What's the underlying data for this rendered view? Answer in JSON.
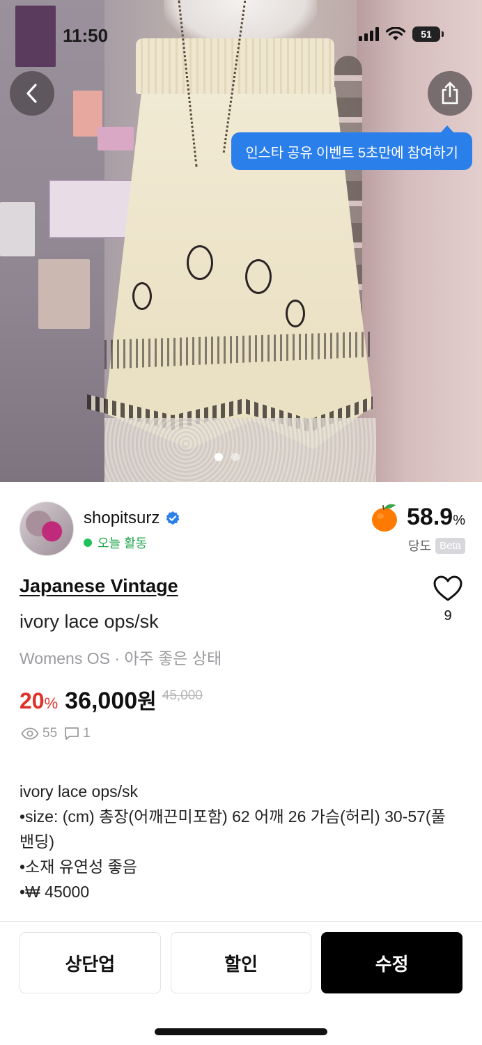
{
  "status_bar": {
    "time": "11:50",
    "battery": "51"
  },
  "hero": {
    "tooltip": "인스타 공유 이벤트 5초만에 참여하기",
    "page_count": 2,
    "active_page": 1
  },
  "seller": {
    "name": "shopitsurz",
    "activity": "오늘 활동",
    "temperature": "58.9",
    "temperature_unit": "%",
    "temperature_label": "당도",
    "beta_label": "Beta"
  },
  "product": {
    "brand": "Japanese Vintage",
    "title": "ivory lace ops/sk",
    "meta": "Womens OS · 아주 좋은 상태",
    "discount_value": "20",
    "discount_unit": "%",
    "price": "36,000",
    "price_unit": "원",
    "original_price": "45,000",
    "likes": "9",
    "views": "55",
    "chats": "1"
  },
  "description": "ivory lace ops/sk\n•size: (cm) 총장(어깨끈미포함) 62 어깨 26 가슴(허리) 30-57(풀\n밴딩)\n•소재 유연성 좋음\n•₩ 45000",
  "actions": {
    "bump": "상단업",
    "discount": "할인",
    "edit": "수정"
  },
  "colors": {
    "accent_blue": "#2b7fea",
    "discount_red": "#e0302a",
    "active_green": "#1fa64c"
  }
}
